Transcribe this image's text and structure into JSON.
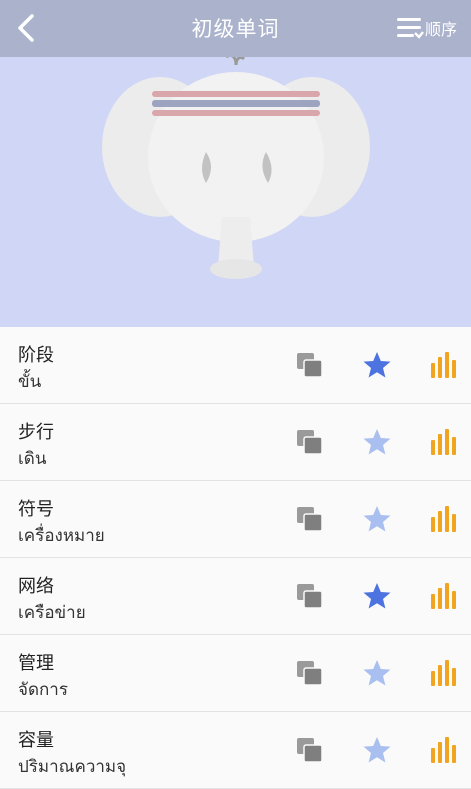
{
  "nav": {
    "title": "初级单词",
    "order_label": "顺序"
  },
  "colors": {
    "nav_bg": "#aab2cc",
    "hero_bg": "#d0d6f5",
    "star_on": "#4d73e0",
    "star_off": "#a9bff0",
    "bars": "#f0a420",
    "copy": "#8c8c8c"
  },
  "words": [
    {
      "word": "阶段",
      "translation": "ขั้น",
      "starred": true
    },
    {
      "word": "步行",
      "translation": "เดิน",
      "starred": false
    },
    {
      "word": "符号",
      "translation": "เครื่องหมาย",
      "starred": false
    },
    {
      "word": "网络",
      "translation": "เครือข่าย",
      "starred": true
    },
    {
      "word": "管理",
      "translation": "จัดการ",
      "starred": false
    },
    {
      "word": "容量",
      "translation": "ปริมาณความจุ",
      "starred": false
    }
  ]
}
